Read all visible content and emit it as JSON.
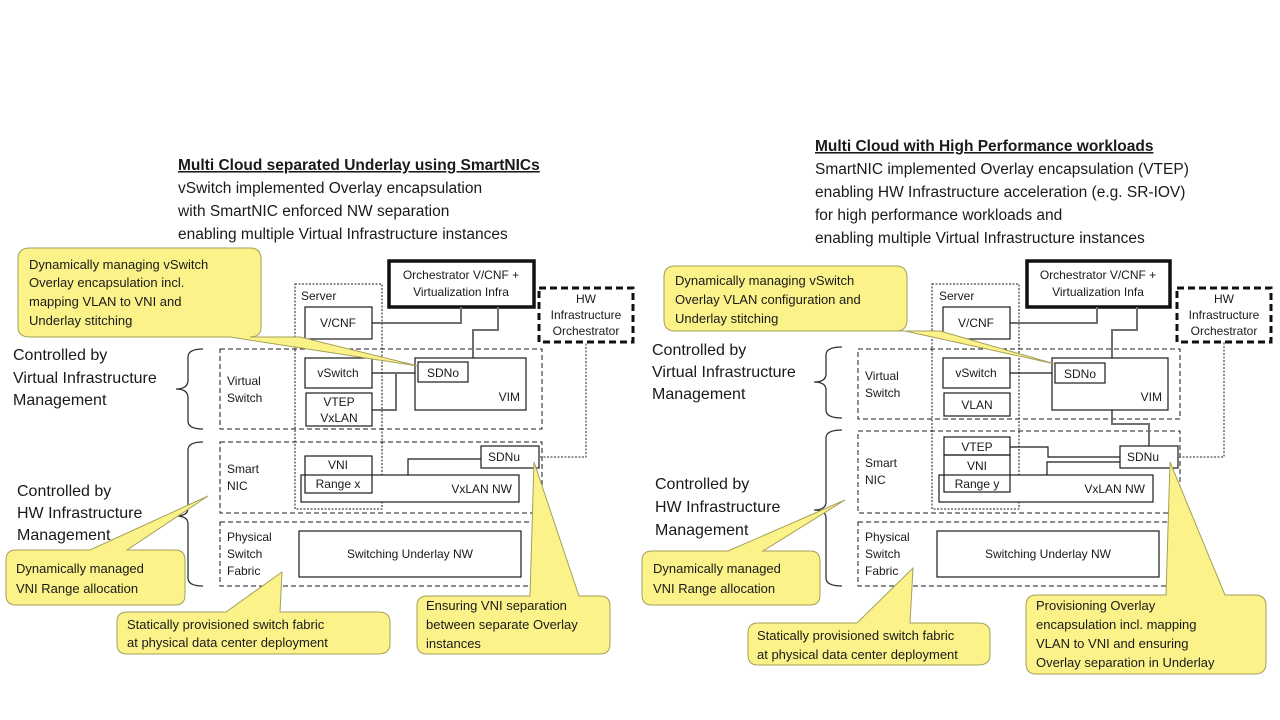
{
  "left": {
    "title": "Multi Cloud separated Underlay using SmartNICs",
    "subtitle_lines": [
      "vSwitch implemented Overlay encapsulation",
      "with SmartNIC enforced NW separation",
      "enabling multiple  Virtual Infrastructure instances"
    ],
    "orchestrator": [
      "Orchestrator V/CNF +",
      "Virtualization Infra"
    ],
    "hw_orchestrator": [
      "HW",
      "Infrastructure",
      "Orchestrator"
    ],
    "server_label": "Server",
    "vcnf": "V/CNF",
    "vswitch": "vSwitch",
    "vtep": [
      "VTEP",
      "VxLAN"
    ],
    "sdno": "SDNo",
    "vim": "VIM",
    "vni": "VNI",
    "range": "Range x",
    "sdnu": "SDNu",
    "vxlan_nw": "VxLAN NW",
    "underlay": "Switching Underlay NW",
    "layer_virtual": [
      "Virtual",
      "Switch"
    ],
    "layer_smartnic": [
      "Smart",
      "NIC"
    ],
    "layer_physical": [
      "Physical",
      "Switch",
      "Fabric"
    ],
    "ctrl_vim": [
      "Controlled by",
      "Virtual Infrastructure",
      "Management"
    ],
    "ctrl_hw": [
      "Controlled by",
      "HW Infrastructure",
      "Management"
    ],
    "callout_sdno": [
      "Dynamically managing vSwitch",
      "Overlay encapsulation incl.",
      "mapping VLAN to VNI and",
      "Underlay stitching"
    ],
    "callout_vni": [
      "Dynamically managed",
      "VNI Range allocation"
    ],
    "callout_fabric": [
      "Statically provisioned switch fabric",
      "at physical data center deployment"
    ],
    "callout_sdnu": [
      "Ensuring VNI separation",
      "between  separate Overlay",
      "instances"
    ]
  },
  "right": {
    "title": "Multi Cloud with High Performance workloads",
    "subtitle_lines": [
      "SmartNIC implemented Overlay encapsulation (VTEP)",
      "enabling HW Infrastructure acceleration (e.g. SR-IOV)",
      "for high performance workloads and",
      "enabling multiple  Virtual Infrastructure instances"
    ],
    "orchestrator": [
      "Orchestrator V/CNF +",
      "Virtualization Infa"
    ],
    "hw_orchestrator": [
      "HW",
      "Infrastructure",
      "Orchestrator"
    ],
    "server_label": "Server",
    "vcnf": "V/CNF",
    "vswitch": "vSwitch",
    "vlan": "VLAN",
    "sdno": "SDNo",
    "vim": "VIM",
    "vtep": "VTEP",
    "vni": "VNI",
    "range": "Range y",
    "sdnu": "SDNu",
    "vxlan_nw": "VxLAN NW",
    "underlay": "Switching Underlay NW",
    "layer_virtual": [
      "Virtual",
      "Switch"
    ],
    "layer_smartnic": [
      "Smart",
      "NIC"
    ],
    "layer_physical": [
      "Physical",
      "Switch",
      "Fabric"
    ],
    "ctrl_vim": [
      "Controlled by",
      "Virtual Infrastructure",
      "Management"
    ],
    "ctrl_hw": [
      "Controlled by",
      "HW Infrastructure",
      "Management"
    ],
    "callout_sdno": [
      "Dynamically managing vSwitch",
      "Overlay VLAN configuration and",
      "Underlay stitching"
    ],
    "callout_vni": [
      "Dynamically managed",
      "VNI Range allocation"
    ],
    "callout_fabric": [
      "Statically provisioned switch fabric",
      "at physical data center deployment"
    ],
    "callout_sdnu": [
      "Provisioning Overlay",
      "encapsulation incl. mapping",
      "VLAN to VNI and ensuring",
      "Overlay separation in Underlay"
    ]
  }
}
